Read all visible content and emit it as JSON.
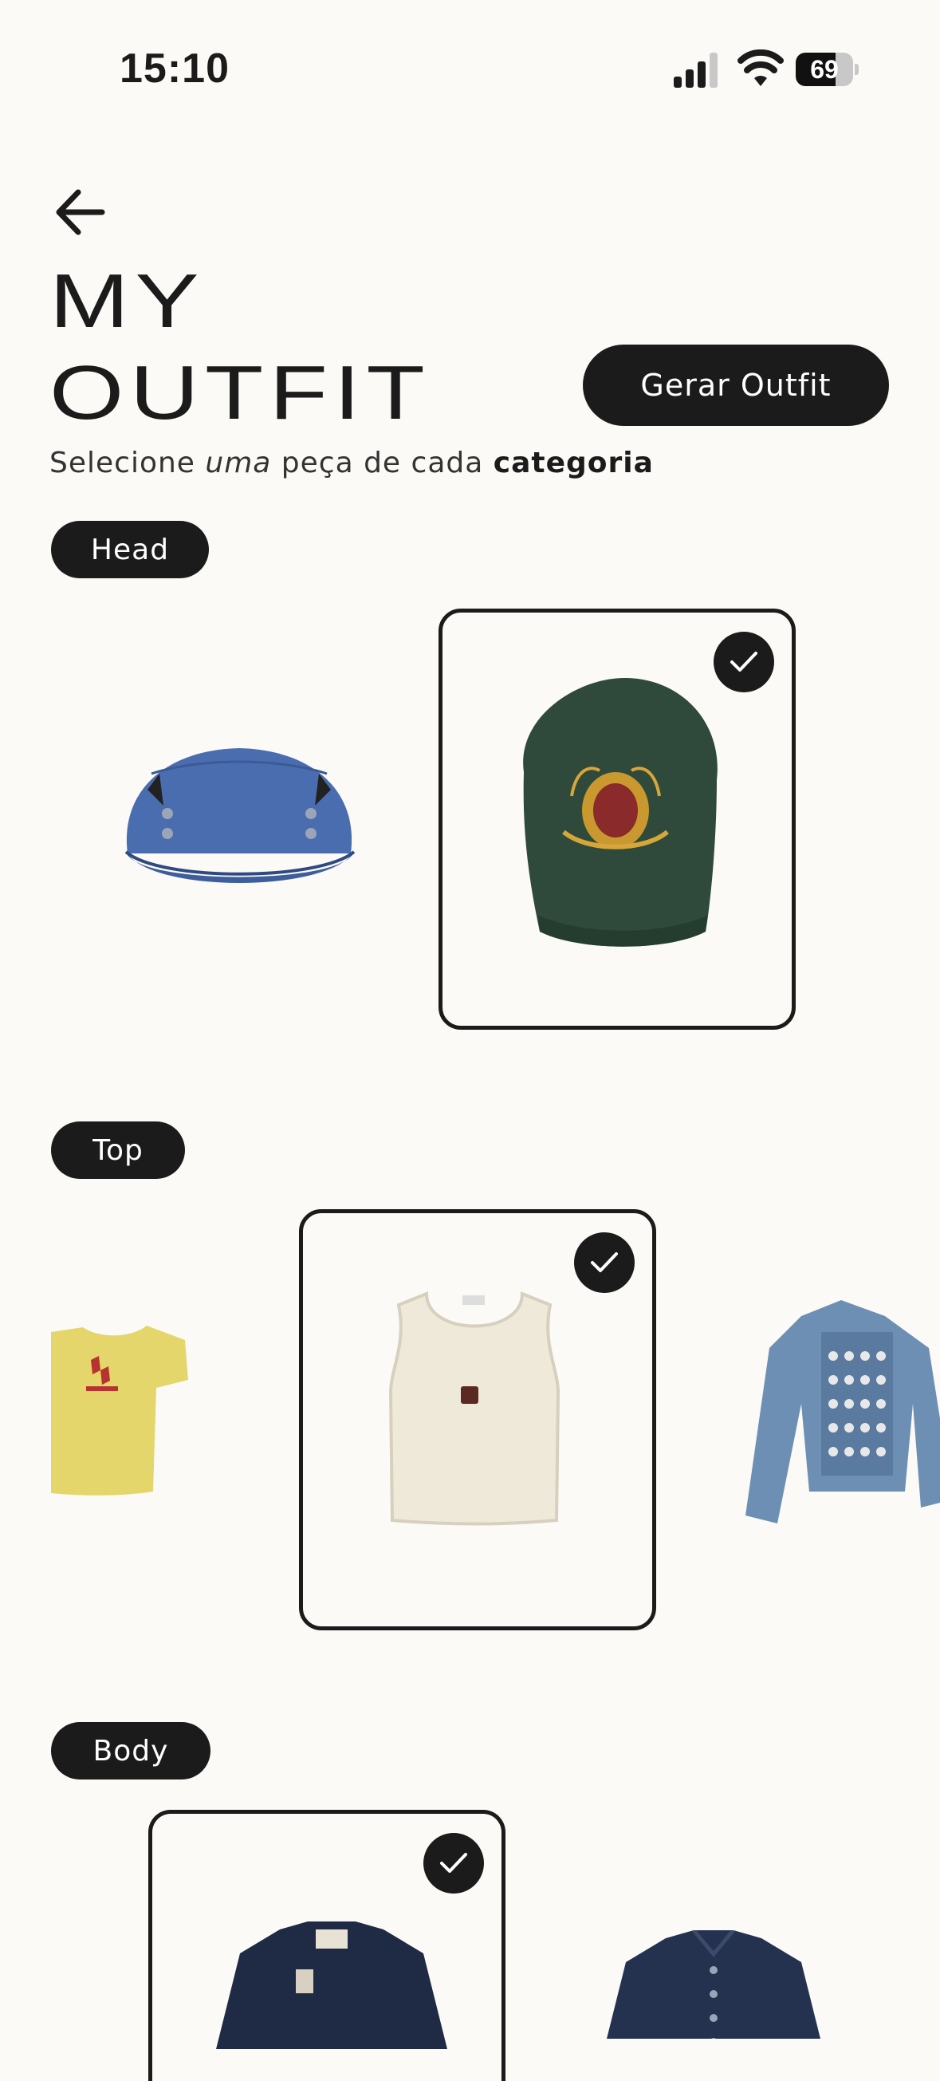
{
  "status_bar": {
    "time": "15:10",
    "battery": "69",
    "battery_level": 0.69
  },
  "header": {
    "title_line1": "MY",
    "title_line2": "OUTFIT",
    "generate_button": "Gerar Outfit",
    "subtitle": {
      "part1": "Selecione ",
      "part2": "uma",
      "part3": " peça de cada ",
      "part4": "categoria"
    }
  },
  "categories": [
    {
      "label": "Head",
      "items": [
        {
          "name": "blue-cap",
          "selected": false
        },
        {
          "name": "green-crest-cap",
          "selected": true
        }
      ]
    },
    {
      "label": "Top",
      "items": [
        {
          "name": "yellow-tshirt",
          "selected": false
        },
        {
          "name": "white-tank-top",
          "selected": true
        },
        {
          "name": "denim-military-jacket",
          "selected": false
        }
      ]
    },
    {
      "label": "Body",
      "items": [
        {
          "name": "navy-work-jacket",
          "selected": true
        },
        {
          "name": "denim-shirt",
          "selected": false
        }
      ]
    }
  ],
  "colors": {
    "background": "#fbfaf6",
    "ink": "#1b1b1b"
  }
}
